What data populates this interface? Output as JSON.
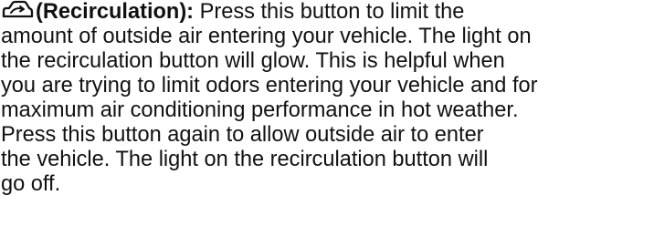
{
  "paragraph": {
    "icon": "recirculation-car-icon",
    "term": "(Recirculation):",
    "lines": [
      " Press this button to limit the",
      "amount of outside air entering your vehicle. The light on",
      "the recirculation button will glow. This is helpful when",
      "you are trying to limit odors entering your vehicle and for",
      "maximum air conditioning performance in hot weather.",
      "Press this button again to allow outside air to enter",
      "the vehicle. The light on the recirculation button will",
      "go off."
    ]
  }
}
